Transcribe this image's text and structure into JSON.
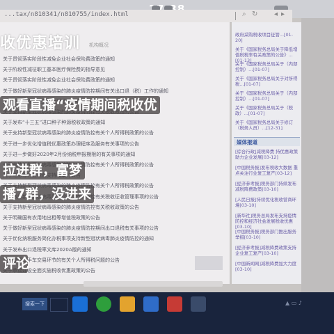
{
  "status_bar": {
    "time": "17:38"
  },
  "browser": {
    "url": "...tax/n810341/n810755/index.html"
  },
  "page": {
    "title": "收优惠培训",
    "title_note": "机构概况",
    "rows": [
      "关于贯彻落实阶段性减免企业社会保险费政策的通知",
      "关于阶段性减征职工基本医疗保险费的指导意见",
      "关于贯彻落实阶段性减免企业社会保险费政策的通知",
      "关于做好新型冠状病毒感染的肺炎疫情防控期间有关出口退（税）工作的通知",
      "关于阶段性减免企业社会保险费的通知",
      "关于支持新型冠状病毒感染的肺炎疫情防控有关税收政策的公告",
      "关于发布“十三五”进口种子种源税收政策的通知",
      "关于支持新型冠状病毒感染的肺炎疫情防控有关个人所得税政策的公告",
      "关于进一步优化增值税优惠政策办理程序及服务有关事项的公告",
      "关于进一步做好2020年2月份纳税申报期限的有关事项的通知",
      "关于支持新型冠状病毒感染的肺炎疫情防控有关个人所得税政策的公告",
      "关于电影等行业税费支持政策的公告",
      "关于支持新型冠状病毒感染的肺炎疫情防控有关个人所得税政策的公告",
      "关于做好新型冠状病毒感染的肺炎疫情防控有关税收征收管理事项的公告",
      "关于支持新型冠状病毒感染的肺炎疫情防控有关税收政策的公告",
      "关于明确国有农用地出租等增值税政策的公告",
      "关于做好新型冠状病毒感染的肺炎疫情防控期间出口退税有关事项的公告",
      "关于优化纳税服务简化办税事项支持新型冠状病毒肺炎疫情防控的通知",
      "关于发布出口退税率文库2020A版的通知",
      "关于取消二手车交易环节的有关个人所得税问题的公告",
      "关于承接建设全面实施税收优惠政策的公告"
    ]
  },
  "sidebar": {
    "items": [
      "政府采购税收项目征管...[01-20]",
      "关于《国家税务总局关于降低增值税税率有关政策的公告》...[01-13]",
      "关于《国家税务总局关于（内部控制）...[01-07]",
      "关于《国家税务总局关于对所得税...[01-07]",
      "关于《国家税务总局关于（内部控制）...[01-07]",
      "关于《国家税务总局关于（税政）...[01-07]",
      "关于《国家税务总局关于修订（税务人员）...[12-31]"
    ],
    "media_header": "媒体报道",
    "media_items": [
      "[综合行政]减税降费 持优惠政策 助力企业发展[03-12]",
      "[中国税务报]发布税收大数据 重点关注行业复工复产[03-12]",
      "[经济参考报]税务部门持续发布减税降费政策[03-10]",
      "[人民日报]持续优化税收营商环境[03-10]",
      "[新华社]税务总局发布支持疫情防控和经济社会发展税收优惠[03-10]",
      "[中国税务报]税务部门推出服务举措[03-10]",
      "[经济参考报]减税降费政策支持企业复工复产[03-10]",
      "[中国新闻网]减税降费加大力度[03-10]"
    ]
  },
  "overlays": {
    "line1": "观看直播“疫情期间税收优",
    "line2": "拉进群，富梦",
    "line3": "播7群，没进来",
    "line4": "评论"
  },
  "taskbar": {
    "start_label": "搜索一下",
    "icons": [
      "windows-icon",
      "ie-icon",
      "edge-icon",
      "file-explorer-icon",
      "media-icon",
      "store-icon",
      "app-icon"
    ]
  }
}
